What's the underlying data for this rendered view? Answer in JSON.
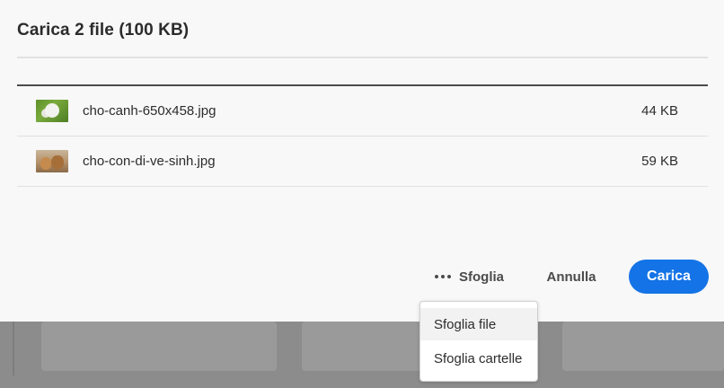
{
  "dialog": {
    "title": "Carica 2 file (100 KB)"
  },
  "files": [
    {
      "name": "cho-canh-650x458.jpg",
      "size": "44 KB",
      "thumbnail": "photo-white-dog-on-grass"
    },
    {
      "name": "cho-con-di-ve-sinh.jpg",
      "size": "59 KB",
      "thumbnail": "photo-puppies"
    }
  ],
  "actions": {
    "more_icon": "ellipsis-icon",
    "browse_label": "Sfoglia",
    "cancel_label": "Annulla",
    "upload_label": "Carica"
  },
  "browse_menu": {
    "items": [
      {
        "label": "Sfoglia file"
      },
      {
        "label": "Sfoglia cartelle"
      }
    ]
  },
  "colors": {
    "accent": "#1473e6",
    "overlay": "#8c8c8c",
    "dialog_bg": "#f8f8f8"
  }
}
